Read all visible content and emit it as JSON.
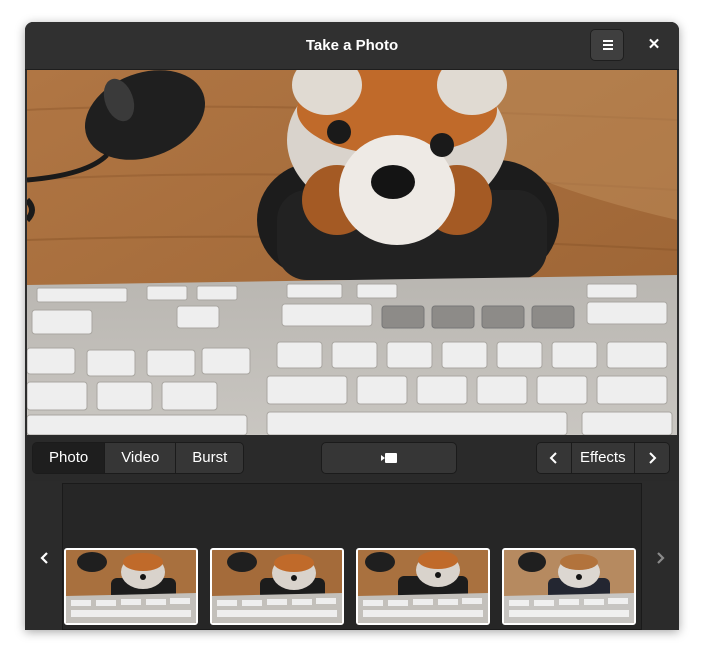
{
  "window": {
    "title": "Take a Photo",
    "menu_icon": "hamburger-menu-icon",
    "close_label": "✕"
  },
  "toolbar": {
    "modes": [
      "Photo",
      "Video",
      "Burst"
    ],
    "active_mode": "Photo",
    "shutter_icon": "camera-icon",
    "effects_label": "Effects",
    "effects_prev_icon": "chevron-left-icon",
    "effects_next_icon": "chevron-right-icon"
  },
  "gallery": {
    "prev_icon": "chevron-left-icon",
    "next_icon": "chevron-right-icon",
    "thumbnail_count": 4
  },
  "colors": {
    "window_bg": "#2d2d2d",
    "headerbar_bg": "#303030",
    "button_bg": "#363636",
    "active_button_bg": "#1e1e1e",
    "text": "#ffffff"
  }
}
